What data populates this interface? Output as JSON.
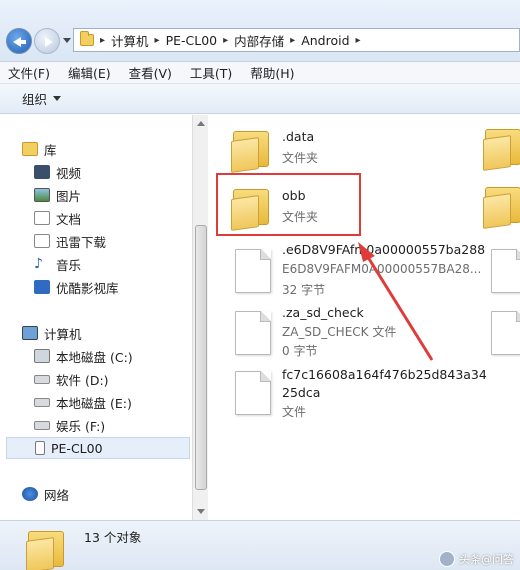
{
  "address": {
    "path": [
      "计算机",
      "PE-CL00",
      "内部存储",
      "Android"
    ]
  },
  "menu": [
    "文件(F)",
    "编辑(E)",
    "查看(V)",
    "工具(T)",
    "帮助(H)"
  ],
  "toolbar": {
    "organize_label": "组织"
  },
  "nav": {
    "library": "库",
    "library_items": [
      "视频",
      "图片",
      "文档",
      "迅雷下载",
      "音乐",
      "优酷影视库"
    ],
    "computer": "计算机",
    "drives": [
      "本地磁盘 (C:)",
      "软件 (D:)",
      "本地磁盘 (E:)",
      "娱乐 (F:)",
      "PE-CL00"
    ],
    "network": "网络"
  },
  "files": [
    {
      "name": ".data",
      "sub1": "文件夹",
      "sub2": "",
      "icon": "folder-icon"
    },
    {
      "name": "obb",
      "sub1": "文件夹",
      "sub2": "",
      "icon": "folder-icon"
    },
    {
      "name": ".e6D8V9FAfm0a00000557ba288",
      "sub1": "E6D8V9FAFM0A00000557BA28...",
      "sub2": "32 字节",
      "icon": "file-icon"
    },
    {
      "name": ".za_sd_check",
      "sub1": "ZA_SD_CHECK 文件",
      "sub2": "0 字节",
      "icon": "file-icon"
    },
    {
      "name": "fc7c16608a164f476b25d843a34",
      "name2": "25dca",
      "sub1": "文件",
      "sub2": "",
      "icon": "file-icon"
    }
  ],
  "status": {
    "count_text": "13 个对象"
  },
  "watermark": "头条@问答",
  "colors": {
    "highlight": "#e03b3b",
    "arrow": "#e03b3b"
  }
}
